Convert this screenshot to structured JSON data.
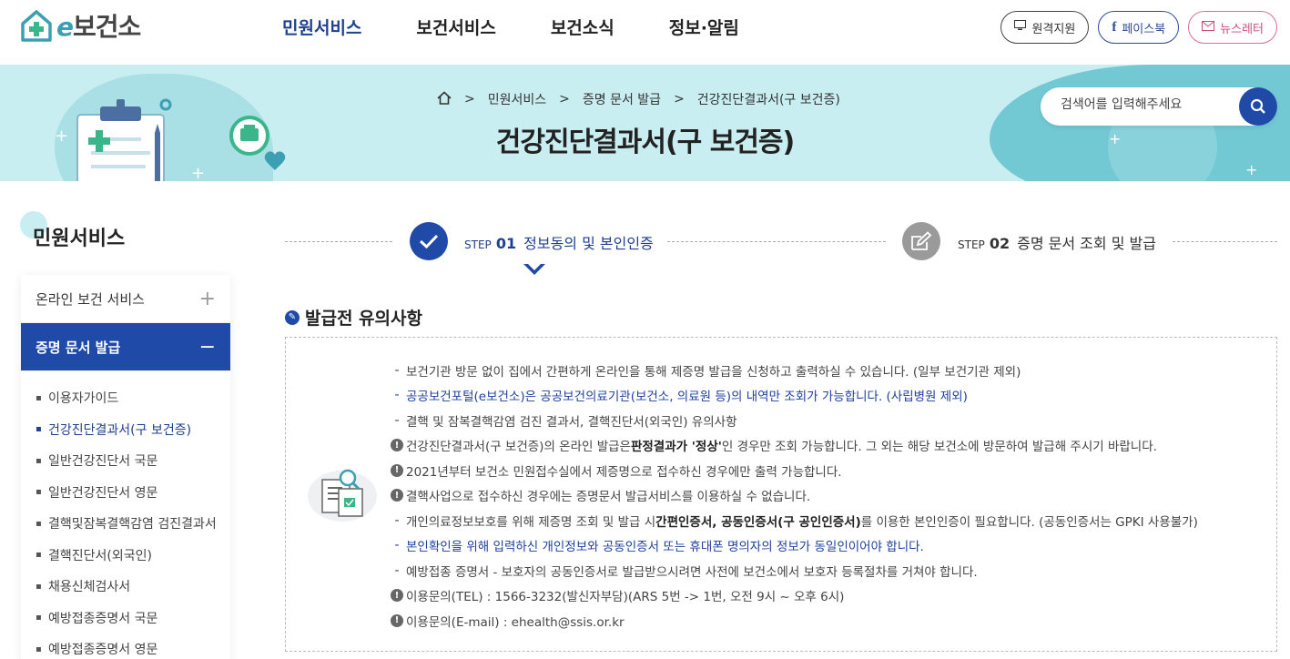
{
  "header": {
    "logo_e": "e",
    "logo_rest": "보건소",
    "nav": [
      "민원서비스",
      "보건서비스",
      "보건소식",
      "정보·알림"
    ],
    "nav_active": 0,
    "util": {
      "remote": "원격지원",
      "facebook": "페이스북",
      "newsletter": "뉴스레터"
    }
  },
  "banner": {
    "breadcrumb": [
      "민원서비스",
      "증명 문서 발급",
      "건강진단결과서(구 보건증)"
    ],
    "title": "건강진단결과서(구 보건증)",
    "search_placeholder": "검색어를 입력해주세요"
  },
  "sidebar": {
    "title": "민원서비스",
    "groups": [
      {
        "label": "온라인 보건 서비스",
        "toggle": "+"
      },
      {
        "label": "증명 문서 발급",
        "toggle": "−"
      }
    ],
    "sub_items": [
      "이용자가이드",
      "건강진단결과서(구 보건증)",
      "일반건강진단서 국문",
      "일반건강진단서 영문",
      "결핵및잠복결핵감염 검진결과서",
      "결핵진단서(외국인)",
      "채용신체검사서",
      "예방접종증명서 국문",
      "예방접종증명서 영문"
    ],
    "sub_active": 1
  },
  "steps": {
    "step1": {
      "prefix": "STEP",
      "num": "01",
      "label": "정보동의 및 본인인증"
    },
    "step2": {
      "prefix": "STEP",
      "num": "02",
      "label": "증명 문서 조회 및 발급"
    }
  },
  "notice": {
    "title": "발급전 유의사항",
    "lines": [
      {
        "type": "dash",
        "style": "normal",
        "text": "보건기관 방문 없이 집에서 간편하게 온라인을 통해 제증명 발급을 신청하고 출력하실 수 있습니다. (일부 보건기관 제외)"
      },
      {
        "type": "dash",
        "style": "blue",
        "text": "공공보건포털(e보건소)은 공공보건의료기관(보건소, 의료원 등)의 내역만 조회가 가능합니다. (사립병원 제외)"
      },
      {
        "type": "dash",
        "style": "normal",
        "text": "결핵 및 잠복결핵감염 검진 결과서, 결핵진단서(외국인) 유의사항"
      },
      {
        "type": "warn",
        "style": "normal",
        "text_a": "건강진단결과서(구 보건증)의 온라인 발급은 ",
        "bold": "판정결과가 '정상'",
        "text_b": "인 경우만 조회 가능합니다. 그 외는 해당 보건소에 방문하여 발급해 주시기 바랍니다."
      },
      {
        "type": "warn",
        "style": "normal",
        "text": "2021년부터 보건소 민원접수실에서 제증명으로 접수하신 경우에만 출력 가능합니다."
      },
      {
        "type": "warn",
        "style": "normal",
        "text": "결핵사업으로 접수하신 경우에는 증명문서 발급서비스를 이용하실 수 없습니다."
      },
      {
        "type": "dash",
        "style": "normal",
        "text_a": "개인의료정보보호를 위해 제증명 조회 및 발급 시 ",
        "bold": "간편인증서, 공동인증서(구 공인인증서)",
        "text_b": "를 이용한 본인인증이 필요합니다. (공동인증서는 GPKI 사용불가)"
      },
      {
        "type": "dash",
        "style": "blue",
        "text": "본인확인을 위해 입력하신 개인정보와 공동인증서 또는 휴대폰 명의자의 정보가 동일인이어야 합니다."
      },
      {
        "type": "dash",
        "style": "normal",
        "text": "예방접종 증명서 - 보호자의 공동인증서로 발급받으시려면 사전에 보건소에서 보호자 등록절차를 거쳐야 합니다."
      },
      {
        "type": "warn",
        "style": "normal",
        "text": "이용문의(TEL) : 1566-3232(발신자부담)(ARS 5번 -> 1번, 오전 9시 ~ 오후 6시)"
      },
      {
        "type": "warn",
        "style": "normal",
        "text": "이용문의(E-mail) : ehealth@ssis.or.kr"
      }
    ]
  },
  "colors": {
    "primary": "#1f4aa8",
    "banner": "#c9eef1",
    "accent": "#3d9fb3"
  }
}
